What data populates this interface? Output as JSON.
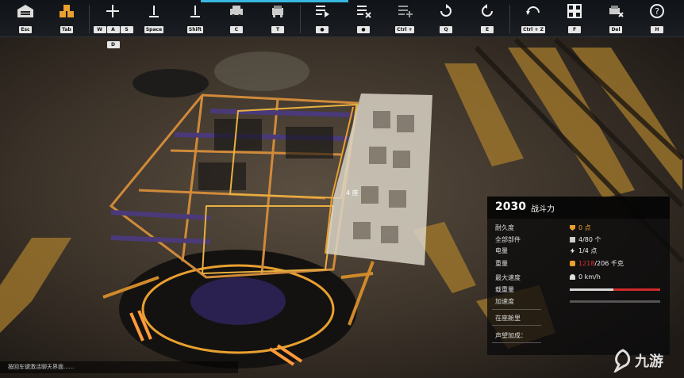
{
  "toolbar": {
    "items": [
      {
        "name": "Esc",
        "key": "Esc"
      },
      {
        "name": "Tab",
        "key": "Tab"
      },
      {
        "name": "WASD",
        "keys": [
          "W",
          "A",
          "S",
          "D"
        ]
      },
      {
        "name": "Space",
        "key": "Space"
      },
      {
        "name": "Shift",
        "key": "Shift"
      },
      {
        "name": "C",
        "key": "C"
      },
      {
        "name": "T",
        "key": "T"
      },
      {
        "name": "Ctrl+",
        "key": "Ctrl + "
      },
      {
        "name": "Q",
        "key": "Q"
      },
      {
        "name": "E",
        "key": "E"
      },
      {
        "name": "CtrlZ",
        "key": "Ctrl + Z"
      },
      {
        "name": "F",
        "key": "F"
      },
      {
        "name": "Del",
        "key": "Del"
      },
      {
        "name": "H",
        "key": "H"
      }
    ]
  },
  "scene": {
    "block_count": "4 座"
  },
  "stats": {
    "power_value": "2030",
    "power_label": "战斗力",
    "rows": [
      {
        "label": "耐久度",
        "value": "0 点",
        "value_color": "#e8a030"
      },
      {
        "label": "全部部件",
        "value": "4/80 个"
      },
      {
        "label": "电量",
        "value": "1/4 点"
      },
      {
        "label": "重量",
        "value_over": "1218",
        "value_rest": "/206 千克",
        "over_color": "#e03030"
      },
      {
        "label": "最大速度",
        "value": "0 km/h"
      },
      {
        "label": "载重量",
        "value": ""
      },
      {
        "label": "加速度",
        "value": ""
      }
    ],
    "bars": [
      {
        "name": "load-bar",
        "fraction": 0.48,
        "accent": 0.52
      },
      {
        "name": "accel-bar",
        "fraction": 0.0
      }
    ],
    "extra_rows": [
      {
        "label": "在座舱里"
      },
      {
        "label": "声望加成："
      }
    ]
  },
  "chat": {
    "hint": "按回车键激活聊天界面......"
  },
  "watermark": {
    "text": "九游"
  }
}
